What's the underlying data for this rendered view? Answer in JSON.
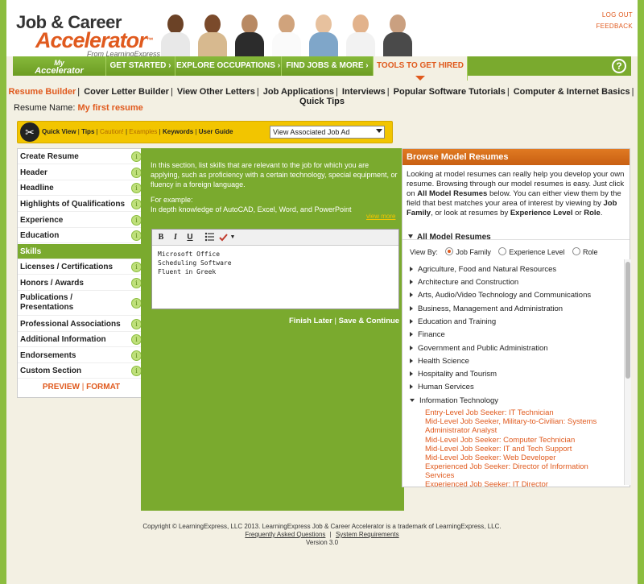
{
  "header": {
    "logo_line1": "Job & Career",
    "logo_line2": "Accelerator",
    "logo_tm": "™",
    "logo_line3": "From LearningExpress",
    "logout": "LOG OUT",
    "feedback": "FEEDBACK"
  },
  "nav": {
    "my_accelerator_top": "My",
    "my_accelerator_bottom": "Accelerator",
    "items": [
      {
        "label": "GET STARTED ›"
      },
      {
        "label": "EXPLORE OCCUPATIONS ›"
      },
      {
        "label": "FIND JOBS & MORE ›"
      },
      {
        "label": "TOOLS TO GET HIRED"
      }
    ],
    "help": "?"
  },
  "subnav": [
    {
      "label": "Resume Builder",
      "active": true
    },
    {
      "label": "Cover Letter Builder"
    },
    {
      "label": "View Other Letters"
    },
    {
      "label": "Job Applications"
    },
    {
      "label": "Interviews"
    },
    {
      "label": "Popular Software Tutorials"
    },
    {
      "label": "Computer & Internet Basics"
    },
    {
      "label": "Quick Tips"
    }
  ],
  "resume_name": {
    "label": "Resume Name:",
    "value": "My first resume"
  },
  "toolbar": {
    "quick_view": "Quick View",
    "tips": "Tips",
    "caution": "Caution!",
    "examples": "Examples",
    "keywords": "Keywords",
    "user_guide": "User Guide",
    "select_value": "View Associated Job Ad"
  },
  "sidebar": {
    "items": [
      {
        "label": "Create Resume"
      },
      {
        "label": "Header"
      },
      {
        "label": "Headline"
      },
      {
        "label": "Highlights of Qualifications"
      },
      {
        "label": "Experience"
      },
      {
        "label": "Education"
      },
      {
        "label": "Skills"
      },
      {
        "label": "Licenses / Certifications"
      },
      {
        "label": "Honors / Awards"
      },
      {
        "label": "Publications / Presentations"
      },
      {
        "label": "Professional Associations"
      },
      {
        "label": "Additional Information"
      },
      {
        "label": "Endorsements"
      },
      {
        "label": "Custom Section"
      }
    ],
    "preview": "PREVIEW",
    "format": "FORMAT",
    "info_icon": "i"
  },
  "editor": {
    "intro": "In this section, list skills that are relevant to the job for which you are applying, such as proficiency with a certain technology, special equipment, or fluency in a foreign language.",
    "example_label": "For example:",
    "example_text": "In depth knowledge of AutoCAD, Excel, Word, and PowerPoint",
    "view_more": "view more",
    "bold": "B",
    "italic": "I",
    "underline": "U",
    "lines": [
      "Microsoft Office",
      "Scheduling Software",
      "Fluent in Greek"
    ],
    "finish_later": "Finish Later",
    "save_continue": "Save & Continue"
  },
  "browse": {
    "title": "Browse Model Resumes",
    "desc_1": "Looking at model resumes can really help you develop your own resume. Browsing through our model resumes is easy. Just click on ",
    "desc_bold_1": "All Model Resumes",
    "desc_2": " below. You can either view them by the field that best matches your area of interest by viewing by ",
    "desc_bold_2": "Job Family",
    "desc_3": ", or look at resumes by ",
    "desc_bold_3": "Experience Level",
    "desc_4": " or ",
    "desc_bold_4": "Role",
    "desc_5": ".",
    "all_label": "All Model Resumes",
    "view_by_label": "View By:",
    "view_by_options": [
      "Job Family",
      "Experience Level",
      "Role"
    ],
    "categories": [
      "Agriculture, Food and Natural Resources",
      "Architecture and Construction",
      "Arts, Audio/Video Technology and Communications",
      "Business, Management and Administration",
      "Education and Training",
      "Finance",
      "Government and Public Administration",
      "Health Science",
      "Hospitality and Tourism",
      "Human Services",
      "Information Technology"
    ],
    "it_items": [
      "Entry-Level Job Seeker: IT Technician",
      "Mid-Level Job Seeker, Military-to-Civilian: Systems Administrator Analyst",
      "Mid-Level Job Seeker: Computer Technician",
      "Mid-Level Job Seeker: IT and Tech Support",
      "Mid-Level Job Seeker: Web Developer",
      "Experienced Job Seeker: Director of Information Services",
      "Experienced Job Seeker: IT Director"
    ]
  },
  "footer": {
    "copyright": "Copyright © LearningExpress, LLC 2013. LearningExpress Job & Career Accelerator is a trademark of LearningExpress, LLC.",
    "faq": "Frequently Asked Questions",
    "sysreq": "System Requirements",
    "version": "Version 3.0"
  },
  "colors": {
    "accent_orange": "#e05a1e",
    "brand_green": "#7aaa2e",
    "toolbar_yellow": "#f2c500"
  }
}
